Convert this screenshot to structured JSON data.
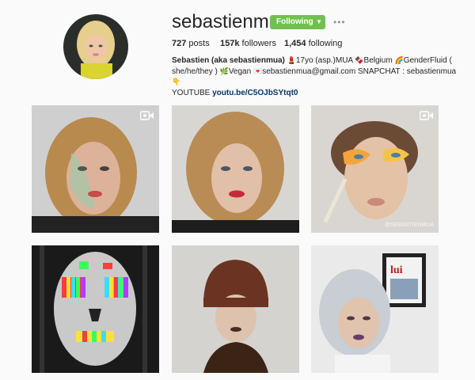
{
  "profile": {
    "username": "sebastienmua",
    "follow_label": "Following",
    "posts_count": "727",
    "posts_label": "posts",
    "followers_count": "157k",
    "followers_label": "followers",
    "following_count": "1,454",
    "following_label": "following"
  },
  "bio": {
    "name": "Sebastien (aka sebastienmua)",
    "part1": "17yo (asp.)MUA",
    "part2": "Belgium",
    "part3": "GenderFluid ( she/he/they )",
    "part4": "Vegan",
    "part5": "sebastienmua@gmail.com SNAPCHAT : sebastienmua",
    "part6": "YOUTUBE",
    "link": "youtu.be/C5OJbSYtqt0"
  },
  "posts": [
    {
      "type": "video",
      "description_icon": "video-camera-icon"
    },
    {
      "type": "photo"
    },
    {
      "type": "video",
      "description_icon": "video-camera-icon",
      "watermark": "@SEBASTIENMUA"
    },
    {
      "type": "photo"
    },
    {
      "type": "photo"
    },
    {
      "type": "photo"
    }
  ],
  "colors": {
    "follow_green": "#70c050",
    "link_blue": "#003569",
    "background": "#fafafa"
  }
}
